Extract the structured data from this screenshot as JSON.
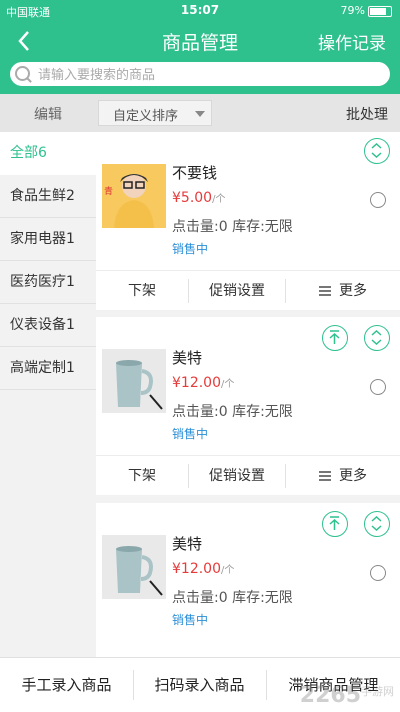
{
  "status_bar": {
    "carrier": "中国联通",
    "time": "15:07",
    "battery": "79%"
  },
  "nav": {
    "title": "商品管理",
    "action": "操作记录"
  },
  "search": {
    "placeholder": "请输入要搜索的商品"
  },
  "toolbar": {
    "edit": "编辑",
    "sort": "自定义排序",
    "batch": "批处理"
  },
  "categories": [
    {
      "label": "全部6",
      "active": true
    },
    {
      "label": "食品生鲜2"
    },
    {
      "label": "家用电器1"
    },
    {
      "label": "医药医疗1"
    },
    {
      "label": "仪表设备1"
    },
    {
      "label": "高端定制1"
    }
  ],
  "products": [
    {
      "name": "不要钱",
      "price": "¥5.00",
      "unit": "/个",
      "stats": "点击量:0 库存:无限",
      "status": "销售中"
    },
    {
      "name": "美特",
      "price": "¥12.00",
      "unit": "/个",
      "stats": "点击量:0 库存:无限",
      "status": "销售中"
    },
    {
      "name": "美特",
      "price": "¥12.00",
      "unit": "/个",
      "stats": "点击量:0 库存:无限",
      "status": "销售中"
    }
  ],
  "card_actions": {
    "offshelf": "下架",
    "promo": "促销设置",
    "more": "更多"
  },
  "bottom": {
    "manual": "手工录入商品",
    "scan": "扫码录入商品",
    "slow": "滞销商品管理"
  },
  "watermark": "2265",
  "watermark_small": "手游网",
  "colors": {
    "accent": "#2ec18e",
    "price": "#e53b3b",
    "status": "#2b8fd6"
  }
}
